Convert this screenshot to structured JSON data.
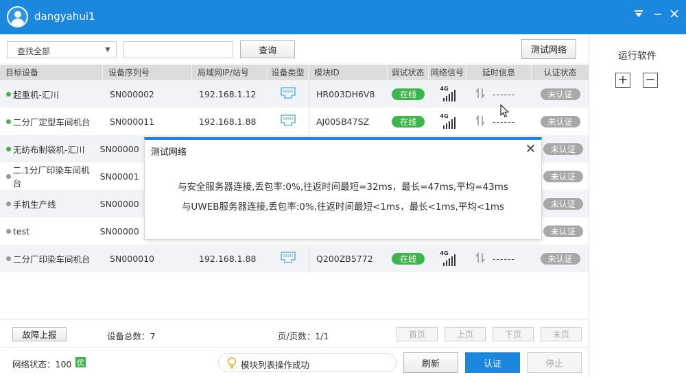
{
  "titlebar": {
    "username": "dangyahui1"
  },
  "search": {
    "scope_selected": "查找全部",
    "query_value": "",
    "search_label": "查询",
    "test_network_label": "测试网络"
  },
  "table": {
    "headers": [
      "目标设备",
      "设备序列号",
      "局域网IP/站号",
      "设备类型",
      "模块ID",
      "调试状态",
      "网络信号",
      "延时信息",
      "认证状态"
    ],
    "rows": [
      {
        "name": "起重机-汇川",
        "online": true,
        "sn": "SN000002",
        "ip": "192.168.1.12",
        "module": "HR003DH6V8",
        "status": "在线",
        "signal": "4G",
        "delay": "------",
        "auth": "未认证"
      },
      {
        "name": "二分厂定型车间机台",
        "online": true,
        "sn": "SN000011",
        "ip": "192.168.1.88",
        "module": "AJ005B47SZ",
        "status": "在线",
        "signal": "4G",
        "delay": "------",
        "auth": "未认证"
      },
      {
        "name": "无纺布制袋机-汇川",
        "online": true,
        "sn": "SN00000",
        "ip": "",
        "module": "",
        "status": "",
        "signal": "",
        "delay": "",
        "auth": "未认证"
      },
      {
        "name": "二.1分厂印染车间机台",
        "online": false,
        "sn": "SN00001",
        "ip": "",
        "module": "",
        "status": "",
        "signal": "",
        "delay": "",
        "auth": "未认证"
      },
      {
        "name": "手机生产线",
        "online": false,
        "sn": "SN00000",
        "ip": "",
        "module": "",
        "status": "",
        "signal": "",
        "delay": "",
        "auth": "未认证"
      },
      {
        "name": "test",
        "online": false,
        "sn": "SN00000",
        "ip": "",
        "module": "",
        "status": "",
        "signal": "",
        "delay": "",
        "auth": "未认证"
      },
      {
        "name": "二分厂印染车间机台",
        "online": false,
        "sn": "SN000010",
        "ip": "192.168.1.88",
        "module": "Q200ZB5772",
        "status": "在线",
        "signal": "4G",
        "delay": "------",
        "auth": "未认证"
      }
    ]
  },
  "dialog": {
    "title": "测试网络",
    "line1": "与安全服务器连接,丢包率:0%,往返时间最短=32ms，最长=47ms,平均=43ms",
    "line2": "与UWEB服务器连接,丢包率:0%,往返时间最短<1ms，最长<1ms,平均<1ms"
  },
  "footer": {
    "report_label": "故障上报",
    "device_total": "设备总数：7",
    "page_info": "页/页数：1/1",
    "first_label": "首页",
    "prev_label": "上页",
    "next_label": "下页",
    "last_label": "末页",
    "network_status": "网络状态：100",
    "network_grade": "优",
    "toast": "模块列表操作成功",
    "refresh_label": "刷新",
    "auth_label": "认证",
    "stop_label": "停止"
  },
  "right_panel": {
    "title": "运行软件",
    "add_symbol": "+",
    "remove_symbol": "−"
  },
  "colors": {
    "brand": "#1b87df",
    "online": "#3cb54a",
    "unauth": "#a8a8a8"
  }
}
